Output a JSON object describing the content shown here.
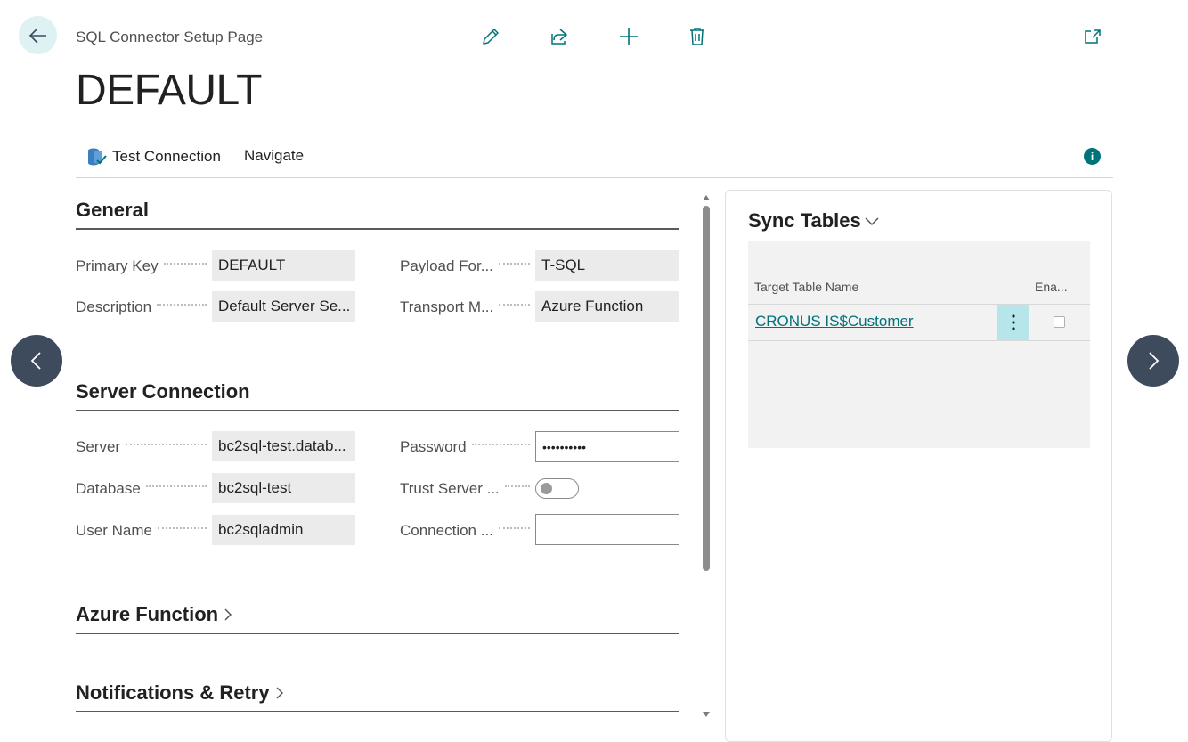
{
  "header": {
    "caption": "SQL Connector Setup Page",
    "title": "DEFAULT"
  },
  "actions": {
    "test_connection": "Test Connection",
    "navigate": "Navigate"
  },
  "general": {
    "title": "General",
    "fields": [
      {
        "label": "Primary Key",
        "value": "DEFAULT"
      },
      {
        "label": "Description",
        "value": "Default Server Se..."
      },
      {
        "label": "Payload For...",
        "value": "T-SQL"
      },
      {
        "label": "Transport M...",
        "value": "Azure Function"
      }
    ]
  },
  "server_connection": {
    "title": "Server Connection",
    "fields": [
      {
        "label": "Server",
        "value": "bc2sql-test.datab..."
      },
      {
        "label": "Database",
        "value": "bc2sql-test"
      },
      {
        "label": "User Name",
        "value": "bc2sqladmin"
      },
      {
        "label": "Password",
        "value": "••••••••••"
      },
      {
        "label": "Trust Server ...",
        "value": "off"
      },
      {
        "label": "Connection ...",
        "value": ""
      }
    ]
  },
  "collapsed_sections": [
    {
      "title": "Azure Function"
    },
    {
      "title": "Notifications & Retry"
    }
  ],
  "sync_tables": {
    "title": "Sync Tables",
    "columns": [
      "Target Table Name",
      "Ena..."
    ],
    "rows": [
      {
        "target_table_name": "CRONUS IS$Customer",
        "enabled": false
      }
    ]
  },
  "colors": {
    "accent": "#00727a",
    "back_button_bg": "#def1f3",
    "nav_arrow_bg": "#3d4b5c",
    "selected_cell_bg": "#b7e6ea",
    "field_bg": "#ebebeb"
  }
}
